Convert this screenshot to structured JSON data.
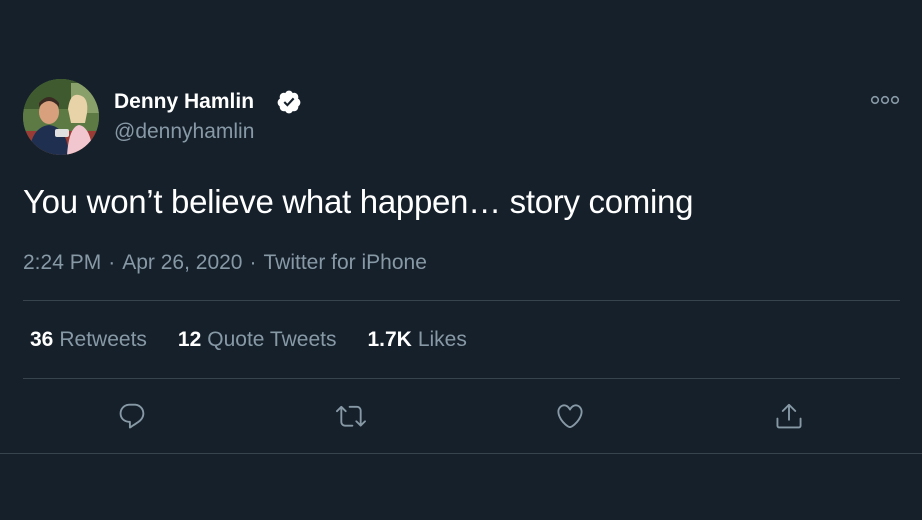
{
  "tweet": {
    "author": {
      "display_name": "Denny Hamlin",
      "handle": "@dennyhamlin",
      "verified": true,
      "avatar": "profile-photo"
    },
    "text": "You won’t believe what happen… story coming",
    "time": "2:24 PM",
    "date": "Apr 26, 2020",
    "separator": "·",
    "source": "Twitter for iPhone",
    "stats": [
      {
        "count": "36",
        "label": "Retweets"
      },
      {
        "count": "12",
        "label": "Quote Tweets"
      },
      {
        "count": "1.7K",
        "label": "Likes"
      }
    ],
    "actions": [
      {
        "name": "reply",
        "icon": "reply-icon"
      },
      {
        "name": "retweet",
        "icon": "retweet-icon"
      },
      {
        "name": "like",
        "icon": "heart-icon"
      },
      {
        "name": "share",
        "icon": "share-icon"
      }
    ]
  },
  "colors": {
    "background": "#15202b",
    "text_primary": "#ffffff",
    "text_secondary": "#8899a6",
    "divider": "#38444d",
    "verified_badge": "#ffffff"
  }
}
